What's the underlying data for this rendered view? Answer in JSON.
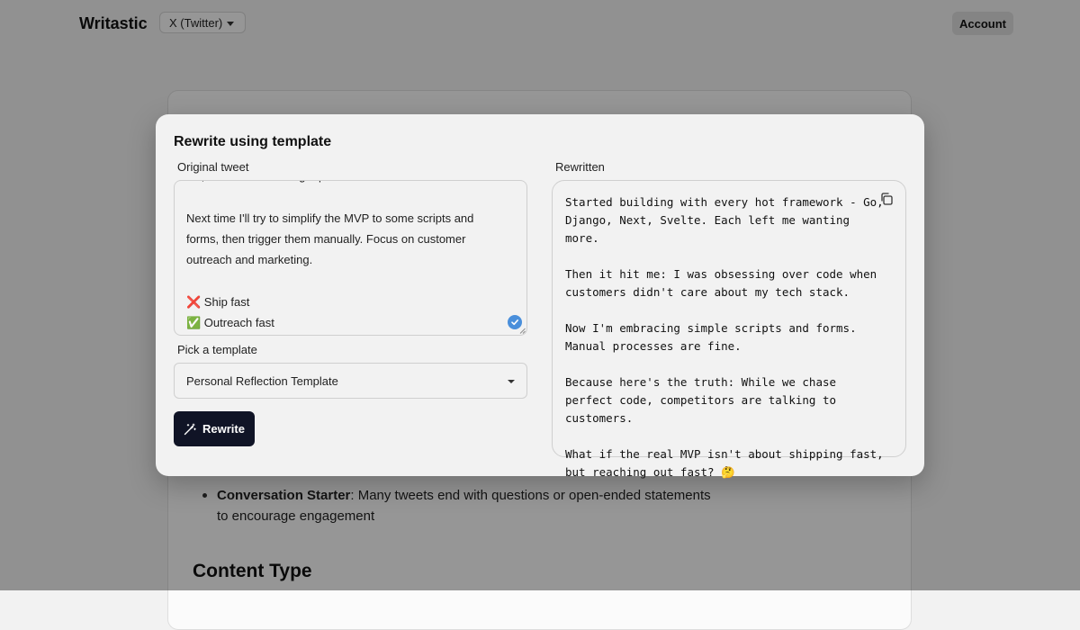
{
  "header": {
    "brand": "Writastic",
    "platform_selected": "X (Twitter)",
    "account_label": "Account"
  },
  "background": {
    "bullet_term": "Conversation Starter",
    "bullet_text": ": Many tweets end with questions or open-ended statements to encourage engagement",
    "section_heading": "Content Type"
  },
  "modal": {
    "title": "Rewrite using template",
    "original_label": "Original tweet",
    "original_text": "No, I'm tired of seeking a perfect tech stack.\n\nNext time I'll try to simplify the MVP to some scripts and forms, then trigger them manually. Focus on customer outreach and marketing.\n\n❌ Ship fast\n✅ Outreach fast",
    "template_label": "Pick a template",
    "template_selected": "Personal Reflection Template",
    "rewrite_button": "Rewrite",
    "rewritten_label": "Rewritten",
    "rewritten_text": "Started building with every hot framework - Go, Django, Next, Svelte. Each left me wanting more.\n\nThen it hit me: I was obsessing over code when customers didn't care about my tech stack.\n\nNow I'm embracing simple scripts and forms. Manual processes are fine.\n\nBecause here's the truth: While we chase perfect code, competitors are talking to customers.\n\nWhat if the real MVP isn't about shipping fast, but reaching out fast? 🤔"
  },
  "icons": {
    "copy": "copy-icon",
    "check": "check-circle-icon",
    "wand": "magic-wand-icon",
    "caret": "chevron-down-icon"
  },
  "colors": {
    "primary_button": "#101426",
    "check_badge": "#4a8fdb",
    "overlay": "rgba(0,0,0,0.40)"
  }
}
